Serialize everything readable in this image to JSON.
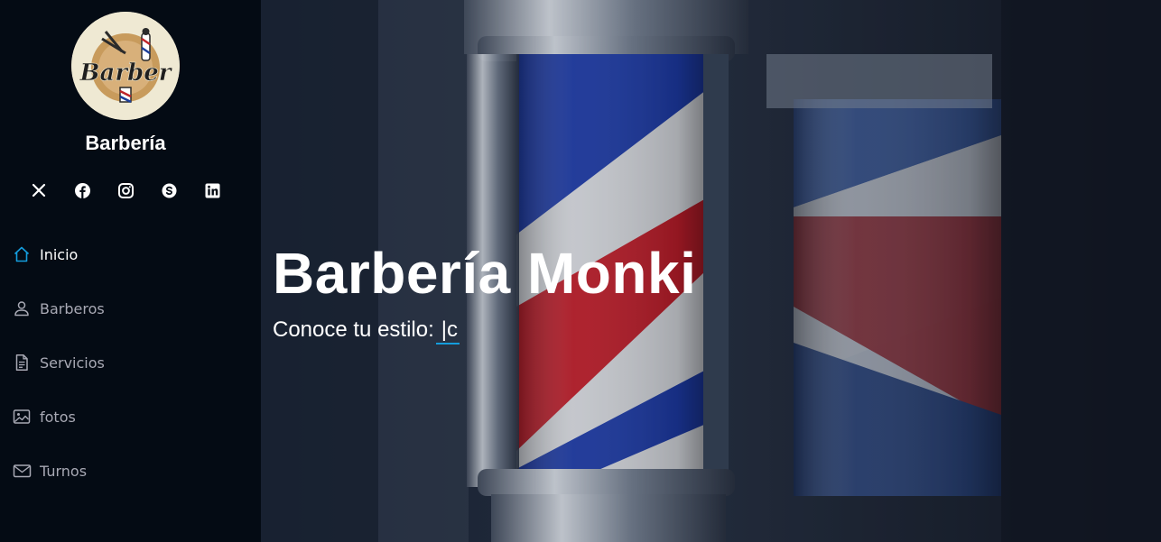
{
  "brand": {
    "logo_text": "Barber",
    "name": "Barbería"
  },
  "socials": [
    {
      "icon": "x-twitter-icon"
    },
    {
      "icon": "facebook-icon"
    },
    {
      "icon": "instagram-icon"
    },
    {
      "icon": "skype-icon"
    },
    {
      "icon": "linkedin-icon"
    }
  ],
  "nav": {
    "items": [
      {
        "label": "Inicio",
        "icon": "home-icon",
        "active": true
      },
      {
        "label": "Barberos",
        "icon": "person-icon",
        "active": false
      },
      {
        "label": "Servicios",
        "icon": "file-text-icon",
        "active": false
      },
      {
        "label": "fotos",
        "icon": "images-icon",
        "active": false
      },
      {
        "label": "Turnos",
        "icon": "envelope-icon",
        "active": false
      }
    ]
  },
  "hero": {
    "title": "Barbería Monki",
    "subtitle": "Conoce tu estilo:",
    "typed_text": "|c"
  },
  "colors": {
    "sidebar_bg": "#040b14",
    "accent": "#149ddd",
    "nav_text": "#a8a9b4",
    "active_text": "#ffffff"
  }
}
